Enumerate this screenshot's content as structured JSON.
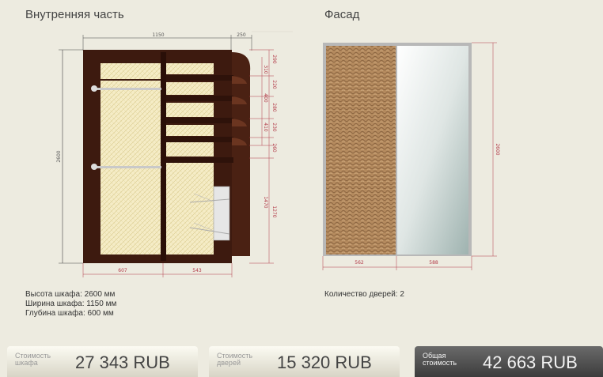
{
  "sections": {
    "inner_title": "Внутренняя часть",
    "facade_title": "Фасад"
  },
  "inner_drawing": {
    "top_dims": [
      "1150",
      "250"
    ],
    "height_dim": "2600",
    "bottom_dims": [
      "607",
      "543"
    ],
    "side_small": [
      "290",
      "310",
      "220",
      "400",
      "280",
      "410",
      "230",
      "260",
      "1470",
      "1270"
    ]
  },
  "facade_drawing": {
    "height_dim": "2600",
    "bottom_dims": [
      "562",
      "588"
    ]
  },
  "specs": {
    "height": "Высота шкафа: 2600 мм",
    "width": "Ширина шкафа: 1150 мм",
    "depth": "Глубина шкафа: 600 мм"
  },
  "facade_info": {
    "doors": "Количество дверей: 2"
  },
  "totals": {
    "cabinet_label_1": "Стоимость",
    "cabinet_label_2": "шкафа",
    "cabinet_value": "27 343  RUB",
    "doors_label_1": "Стоимость",
    "doors_label_2": "дверей",
    "doors_value": "15 320  RUB",
    "total_label_1": "Общая",
    "total_label_2": "стоимость",
    "total_value": "42 663  RUB"
  },
  "colors": {
    "wood_dark": "#3d1a0f",
    "panel_light": "#f3e9be",
    "dim_red": "#b23a48",
    "total_bar": "#4a4a4a"
  }
}
